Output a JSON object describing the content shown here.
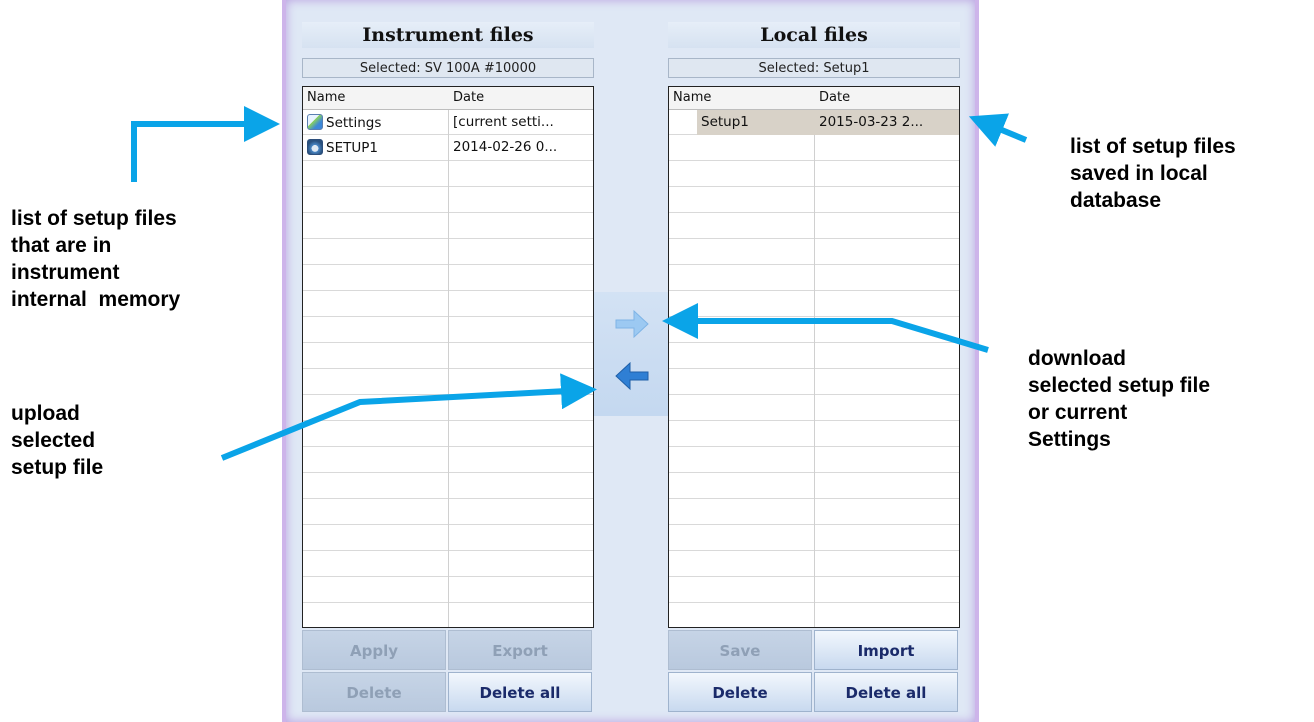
{
  "instrument_panel": {
    "title": "Instrument files",
    "selected": "Selected: SV 100A #10000",
    "columns": [
      "Name",
      "Date"
    ],
    "rows": [
      {
        "icon": "settings-icon",
        "name": "Settings",
        "date": "[current setti..."
      },
      {
        "icon": "setup-file-icon",
        "name": "SETUP1",
        "date": "2014-02-26 0..."
      }
    ],
    "buttons": {
      "apply": "Apply",
      "export": "Export",
      "delete": "Delete",
      "delete_all": "Delete all"
    }
  },
  "local_panel": {
    "title": "Local files",
    "selected": "Selected: Setup1",
    "columns": [
      "Name",
      "Date"
    ],
    "rows": [
      {
        "name": "Setup1",
        "date": "2015-03-23 2..."
      }
    ],
    "buttons": {
      "save": "Save",
      "import": "Import",
      "delete": "Delete",
      "delete_all": "Delete all"
    }
  },
  "center": {
    "download_icon": "arrow-right-icon",
    "upload_icon": "arrow-left-icon"
  },
  "annotations": {
    "instrument_list": [
      "list of setup files",
      "that are in",
      "instrument",
      "internal  memory"
    ],
    "upload": [
      "upload",
      "selected",
      "setup file"
    ],
    "local_list": [
      "list of setup files",
      "saved in local",
      "database"
    ],
    "download": [
      "download",
      "selected setup file",
      "or current",
      "Settings"
    ]
  },
  "colors": {
    "annotation_arrow": "#0aa4e8",
    "frame_glow": "#cdb4ea",
    "window_bg": "#dfe8f5"
  }
}
